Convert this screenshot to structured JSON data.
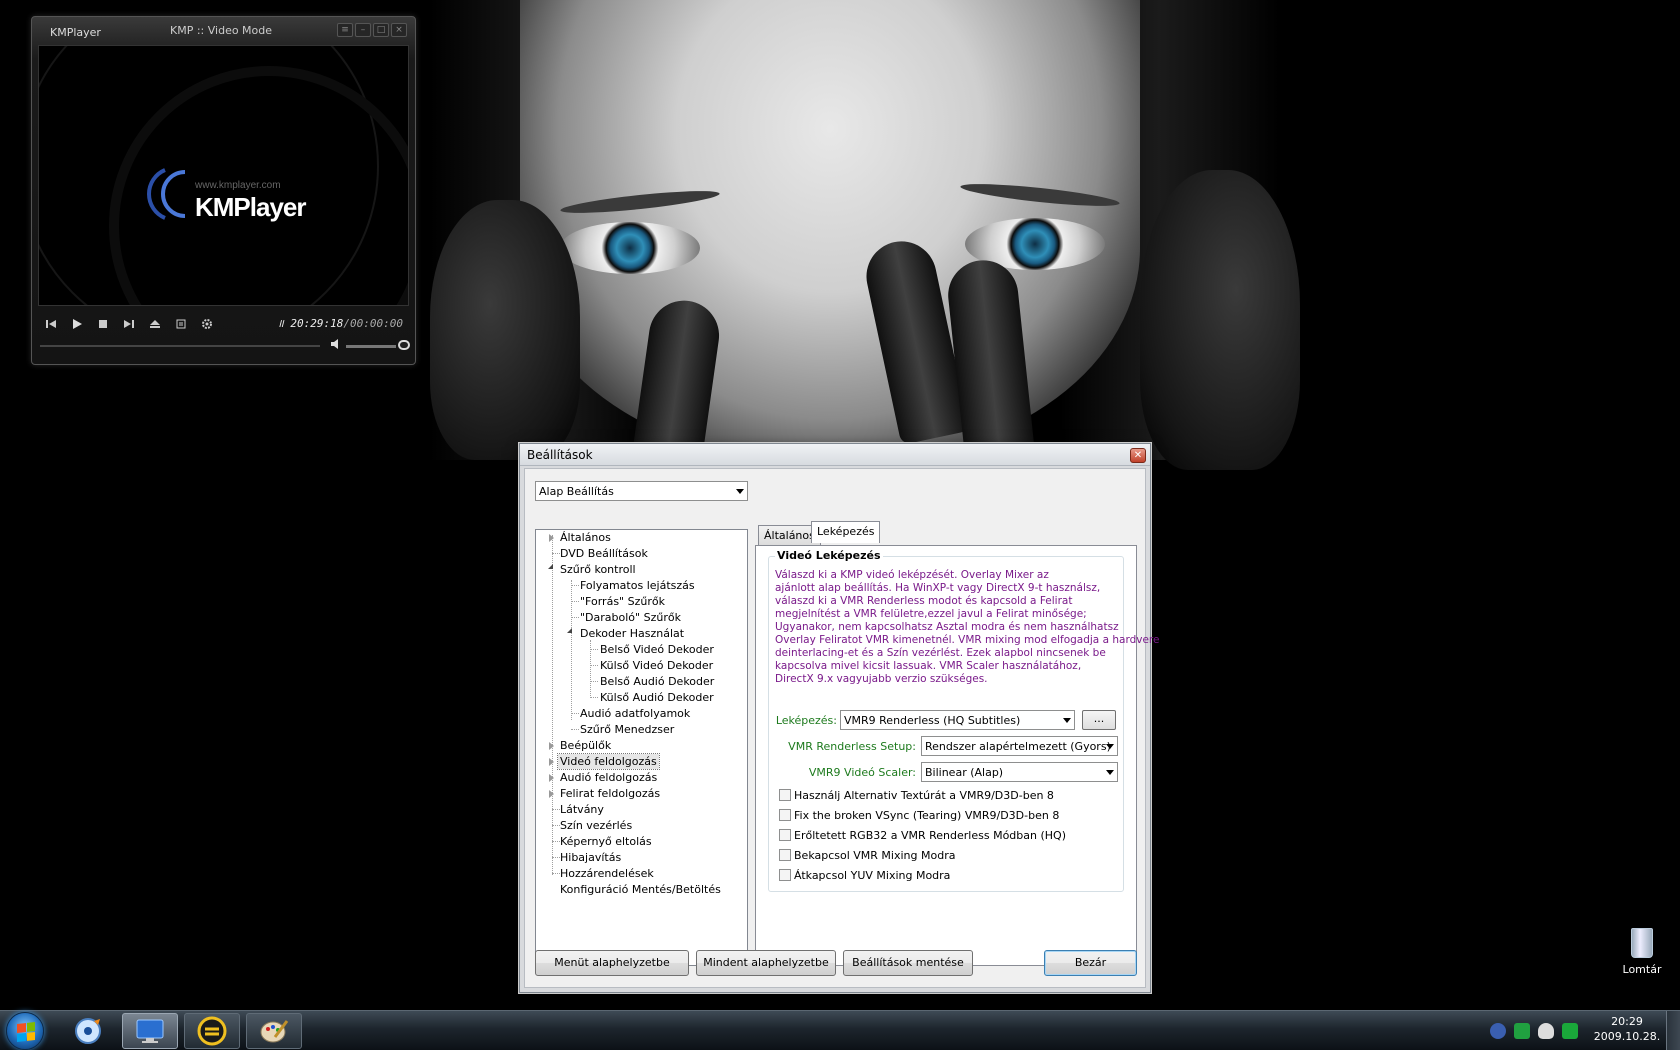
{
  "kmp": {
    "app_title": "KMPlayer",
    "mode_title": "KMP :: Video Mode",
    "logo_url": "www.kmplayer.com",
    "logo_name": "KMPlayer",
    "time_current": "20:29:18",
    "time_total": "/00:00:00",
    "pause_glyph": "॥"
  },
  "dialog": {
    "title": "Beállítások",
    "preset": "Alap Beállítás",
    "tree": [
      "Általános",
      "DVD Beállítások",
      "Szűrő kontroll",
      "Folyamatos lejátszás",
      "\"Forrás\" Szűrők",
      "\"Daraboló\" Szűrők",
      "Dekoder Használat",
      "Belső Videó Dekoder",
      "Külső Videó Dekoder",
      "Belső Audió Dekoder",
      "Külső Audió Dekoder",
      "Audió adatfolyamok",
      "Szűrő Menedzser",
      "Beépülők",
      "Videó feldolgozás",
      "Audió feldolgozás",
      "Felirat feldolgozás",
      "Látvány",
      "Szín vezérlés",
      "Képernyő eltolás",
      "Hibajavítás",
      "Hozzárendelések",
      "Konfiguráció Mentés/Betöltés"
    ],
    "tabs": [
      "Általános",
      "Leképezés"
    ],
    "group_title": "Videó Leképezés",
    "description": [
      "Válaszd ki a KMP videó leképzését. Overlay Mixer az",
      "ajánlott alap beállítás. Ha WinXP-t vagy DirectX 9-t használsz,",
      "válaszd ki a VMR Renderless modot és kapcsold a Felirat",
      "megjelnítést a VMR felületre,ezzel javul a Felirat minősége;",
      "Ugyanakor, nem kapcsolhatsz Asztal modra és nem használhatsz",
      " Overlay Feliratot VMR kimenetnél. VMR mixing mod elfogadja a hardvere",
      "deinterlacing-et és a Szín vezérlést. Ezek alapbol nincsenek be",
      "kapcsolva mivel kicsit lassuak. VMR Scaler használatához,",
      "DirectX 9.x vagyujabb verzio szükséges."
    ],
    "renderer_label": "Leképezés:",
    "renderer_value": "VMR9 Renderless (HQ Subtitles)",
    "more_button": "...",
    "setup_label": "VMR Renderless Setup:",
    "setup_value": "Rendszer alapértelmezett (Gyors)",
    "scaler_label": "VMR9 Videó Scaler:",
    "scaler_value": "Bilinear (Alap)",
    "checkboxes": [
      "Használj Alternativ Textúrát a VMR9/D3D-ben 8",
      "Fix the broken VSync (Tearing)  VMR9/D3D-ben 8",
      "Erőltetett RGB32 a VMR Renderless Módban (HQ)",
      "Bekapcsol VMR Mixing Modra",
      "Átkapcsol YUV Mixing Modra"
    ],
    "buttons": {
      "reset_menu": "Menüt alaphelyzetbe",
      "reset_all": "Mindent alaphelyzetbe",
      "save": "Beállítások mentése",
      "close": "Bezár"
    }
  },
  "desktop": {
    "recycle_bin": "Lomtár"
  },
  "taskbar": {
    "time": "20:29",
    "date": "2009.10.28."
  }
}
